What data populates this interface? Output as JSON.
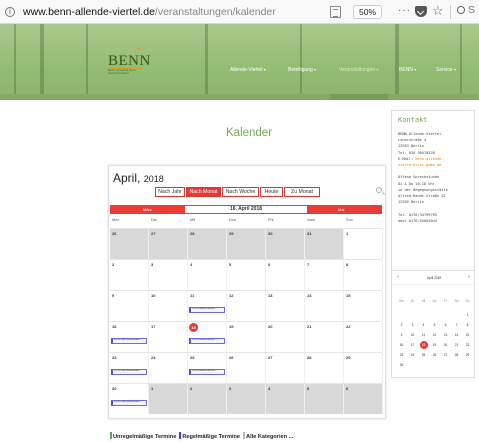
{
  "browser": {
    "url_domain": "www.benn-allende-viertel.de",
    "url_path": "/veranstaltungen/kalender",
    "zoom": "50%",
    "more": "···",
    "search_text": "S"
  },
  "header": {
    "logo_text": "BENN",
    "logo_sub": "Berlin entwickelt Neue Nachbarschaften",
    "nav": [
      "Allende-Viertel",
      "Beteiligung",
      "Veranstaltungen",
      "BENN",
      "Service"
    ]
  },
  "page": {
    "title": "Kalender"
  },
  "calendar": {
    "month": "April,",
    "year": "2018",
    "views": [
      "Nach Jahr",
      "Nach Monat",
      "Nach Woche",
      "Heute",
      "Zu Monat"
    ],
    "prev": "März",
    "next": "Mai",
    "current_date": "16. April 2018",
    "weekdays": [
      "Mon",
      "Die",
      "Mit",
      "Don",
      "Fre",
      "Sam",
      "Son"
    ],
    "weeks": [
      [
        {
          "n": "26",
          "o": true
        },
        {
          "n": "27",
          "o": true
        },
        {
          "n": "28",
          "o": true
        },
        {
          "n": "29",
          "o": true
        },
        {
          "n": "30",
          "o": true
        },
        {
          "n": "31",
          "o": true
        },
        {
          "n": "1",
          "o": false
        }
      ],
      [
        {
          "n": "2"
        },
        {
          "n": "3"
        },
        {
          "n": "4"
        },
        {
          "n": "5"
        },
        {
          "n": "6"
        },
        {
          "n": "7"
        },
        {
          "n": "8"
        }
      ],
      [
        {
          "n": "9"
        },
        {
          "n": "10"
        },
        {
          "n": "11",
          "ev": "14:00 Bewohnertreff ..."
        },
        {
          "n": "12"
        },
        {
          "n": "13"
        },
        {
          "n": "14"
        },
        {
          "n": "15"
        }
      ],
      [
        {
          "n": "16",
          "ev": "15:00 Nachbarschafts ..."
        },
        {
          "n": "17"
        },
        {
          "n": "18",
          "today": true,
          "ev": "14:00 Bewohnertreff ..."
        },
        {
          "n": "19"
        },
        {
          "n": "20"
        },
        {
          "n": "21"
        },
        {
          "n": "22"
        }
      ],
      [
        {
          "n": "23",
          "ev": "15:00 Nachbarschafts ..."
        },
        {
          "n": "24"
        },
        {
          "n": "25",
          "ev": "14:00 Bewohnertreff ..."
        },
        {
          "n": "26"
        },
        {
          "n": "27"
        },
        {
          "n": "28"
        },
        {
          "n": "29"
        }
      ],
      [
        {
          "n": "30",
          "ev": "15:00 Nachbarschafts ..."
        },
        {
          "n": "1",
          "o": true
        },
        {
          "n": "2",
          "o": true
        },
        {
          "n": "3",
          "o": true
        },
        {
          "n": "4",
          "o": true
        },
        {
          "n": "5",
          "o": true
        },
        {
          "n": "6",
          "o": true
        }
      ]
    ]
  },
  "legend": {
    "items": [
      {
        "label": "Unregelmäßige Termine",
        "color": "#4caf50"
      },
      {
        "label": "Regelmäßige Termine",
        "color": "#3f3fd0"
      },
      {
        "label": "Alle Kategorien ...",
        "color": "#bbbbbb"
      }
    ]
  },
  "kontakt": {
    "title": "Kontakt",
    "lines": [
      "BENN-Allende-Viertel",
      "Lynarstraße 4",
      "13583 Berlin",
      "Tel. 030 30470528"
    ],
    "email_label": "E-Mail: ",
    "email": "benn-allende-viertel@list-gmbh.de",
    "email_split": [
      "benn-allende-",
      "viertel@list-gmbh.de"
    ],
    "hours": [
      "Offene Sprechstunde",
      "Di & Do 10-18 Uhr",
      "in der Begegnungsstätte",
      "Alfred-Randt-Straße 42",
      "12559 Berlin"
    ],
    "phones": [
      "Tel. 0176/34799793",
      "oder 0176/55003044"
    ]
  },
  "minical": {
    "prev": "‹",
    "next": "›",
    "month": "April 2018",
    "weekdays": [
      "Mo",
      "Di",
      "Mi",
      "Do",
      "Fr",
      "Sa",
      "So"
    ],
    "days": [
      "",
      "",
      "",
      "",
      "",
      "",
      "1",
      "2",
      "3",
      "4",
      "5",
      "6",
      "7",
      "8",
      "9",
      "10",
      "11",
      "12",
      "13",
      "14",
      "15",
      "16",
      "17",
      "18",
      "19",
      "20",
      "21",
      "22",
      "23",
      "24",
      "25",
      "26",
      "27",
      "28",
      "29",
      "30"
    ],
    "today": "18"
  },
  "colors": {
    "accent_red": "#e53a35",
    "brand_green": "#77a756"
  }
}
